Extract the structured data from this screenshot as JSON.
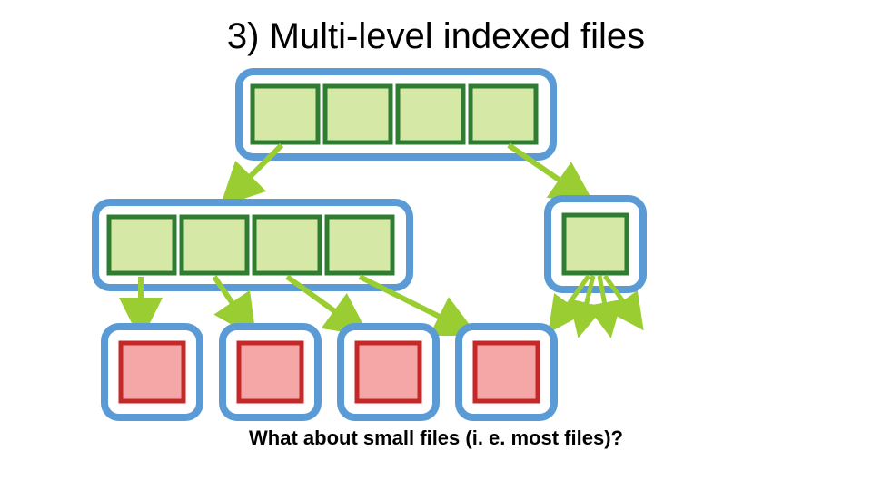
{
  "title": "3) Multi-level indexed files",
  "caption": "What about small files (i. e. most files)?",
  "chart_data": {
    "type": "diagram",
    "description": "Multi-level indexed file allocation tree",
    "levels": [
      {
        "level": 0,
        "role": "top-level index block",
        "blocks": [
          {
            "id": "L0",
            "slots": 4,
            "color": "green",
            "children": [
              "L1a",
              "L1b"
            ]
          }
        ]
      },
      {
        "level": 1,
        "role": "second-level blocks",
        "blocks": [
          {
            "id": "L1a",
            "slots": 4,
            "color": "green",
            "children": [
              "D0",
              "D1",
              "D2",
              "D3"
            ]
          },
          {
            "id": "L1b",
            "slots": 1,
            "color": "green",
            "children_fanout": 4
          }
        ]
      },
      {
        "level": 2,
        "role": "data blocks",
        "blocks": [
          {
            "id": "D0",
            "slots": 1,
            "color": "red"
          },
          {
            "id": "D1",
            "slots": 1,
            "color": "red"
          },
          {
            "id": "D2",
            "slots": 1,
            "color": "red"
          },
          {
            "id": "D3",
            "slots": 1,
            "color": "red"
          }
        ]
      }
    ],
    "palette": {
      "outer_frame_stroke": "#5b9bd5",
      "outer_frame_fill": "#ffffff",
      "index_block_fill": "#d5e8a6",
      "index_block_stroke": "#2e7d32",
      "data_block_fill": "#f5a6a6",
      "data_block_stroke": "#c62828",
      "arrow": "#9acd32"
    }
  }
}
